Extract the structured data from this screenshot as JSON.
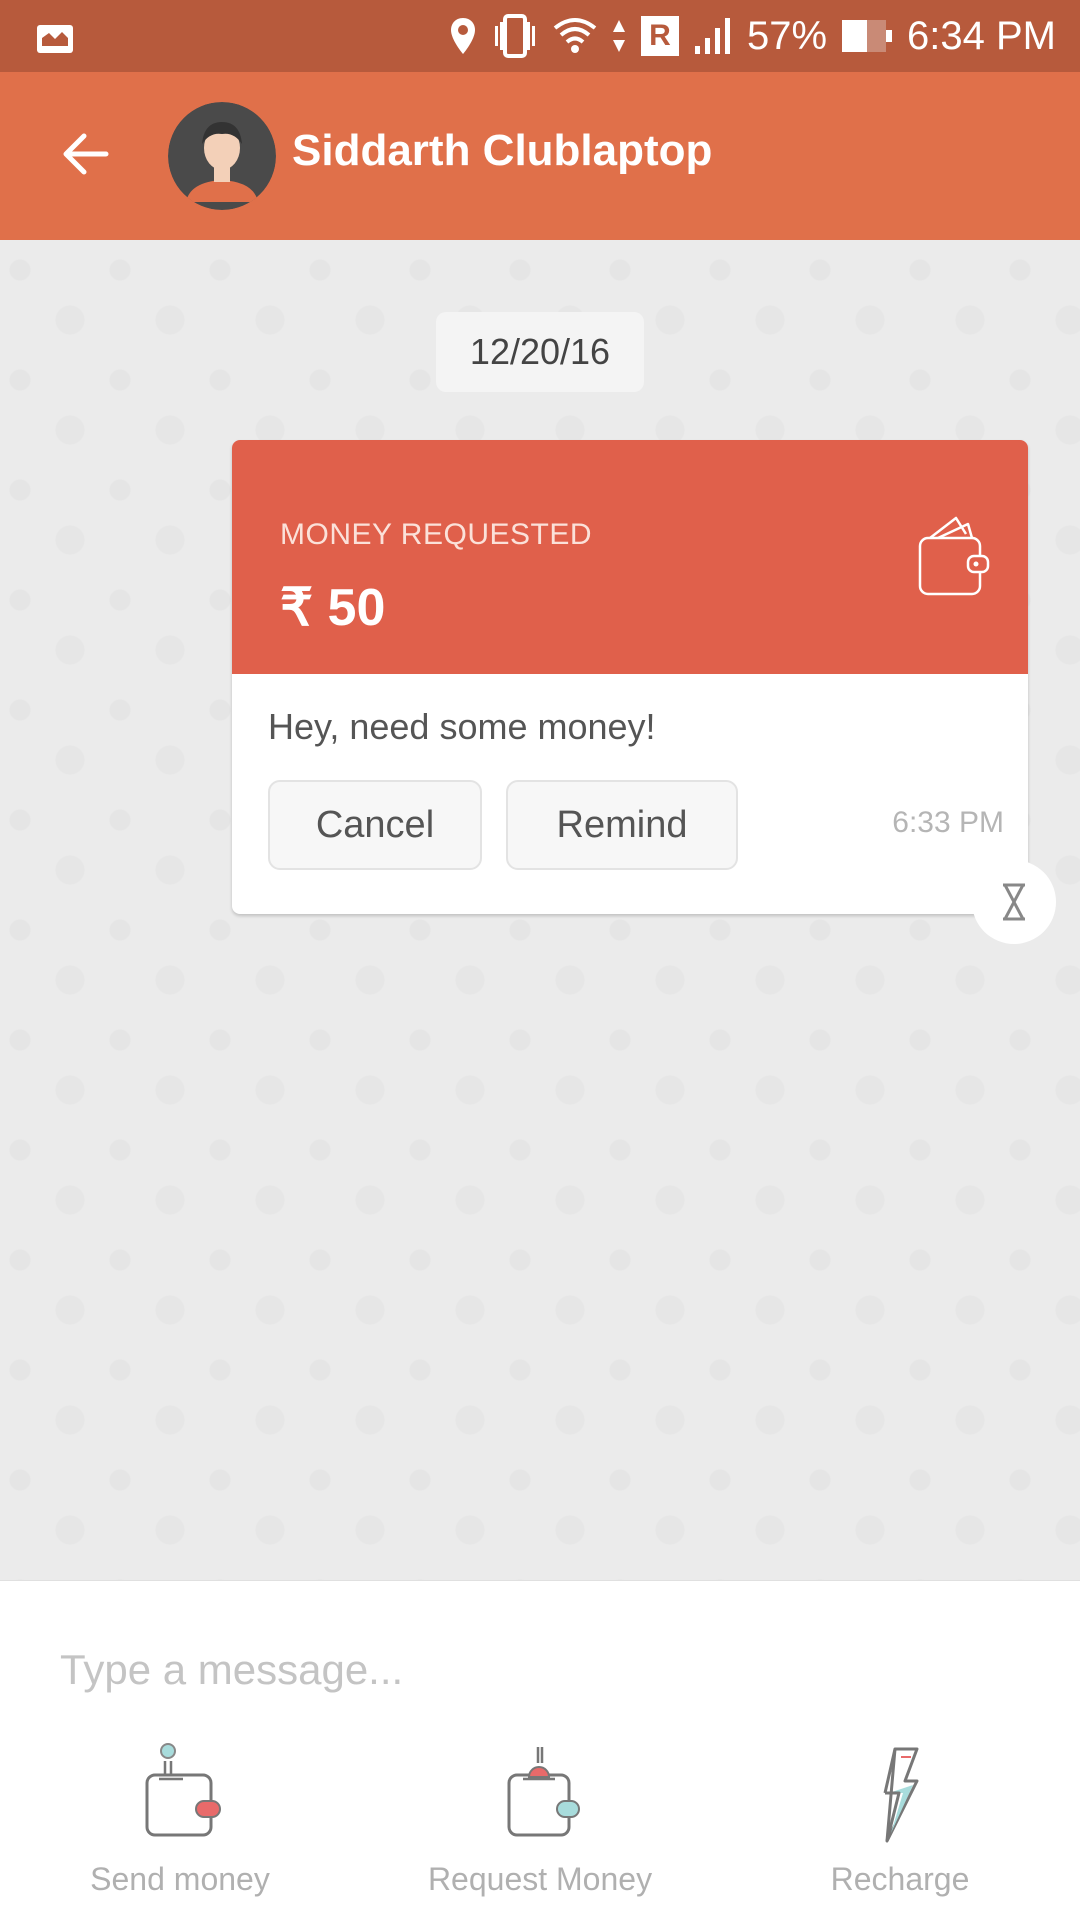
{
  "status_bar": {
    "battery_percent": "57%",
    "time": "6:34 PM",
    "roaming_badge": "R",
    "icons": [
      "gallery-notification-icon",
      "location-icon",
      "vibrate-icon",
      "wifi-icon",
      "data-arrows-icon",
      "roaming-icon",
      "signal-icon",
      "battery-icon"
    ]
  },
  "header": {
    "contact_name": "Siddarth Clublaptop",
    "back_icon": "arrow-left-icon",
    "avatar_icon": "user-avatar-icon"
  },
  "chat": {
    "date_chip": "12/20/16",
    "request_card": {
      "label": "MONEY REQUESTED",
      "amount": "₹ 50",
      "icon": "wallet-icon",
      "message": "Hey, need some money!",
      "cancel_label": "Cancel",
      "remind_label": "Remind",
      "time": "6:33 PM",
      "status_icon": "hourglass-icon"
    }
  },
  "composer": {
    "placeholder": "Type a message...",
    "value": "",
    "actions": [
      {
        "label": "Send money",
        "icon": "send-money-wallet-icon"
      },
      {
        "label": "Request Money",
        "icon": "request-money-wallet-icon"
      },
      {
        "label": "Recharge",
        "icon": "lightning-icon"
      }
    ]
  },
  "colors": {
    "status_bar": "#b75a3c",
    "app_bar": "#e0704a",
    "card_header": "#e0604b",
    "accent_teal": "#a8dcdc",
    "accent_red": "#e86a6a"
  }
}
